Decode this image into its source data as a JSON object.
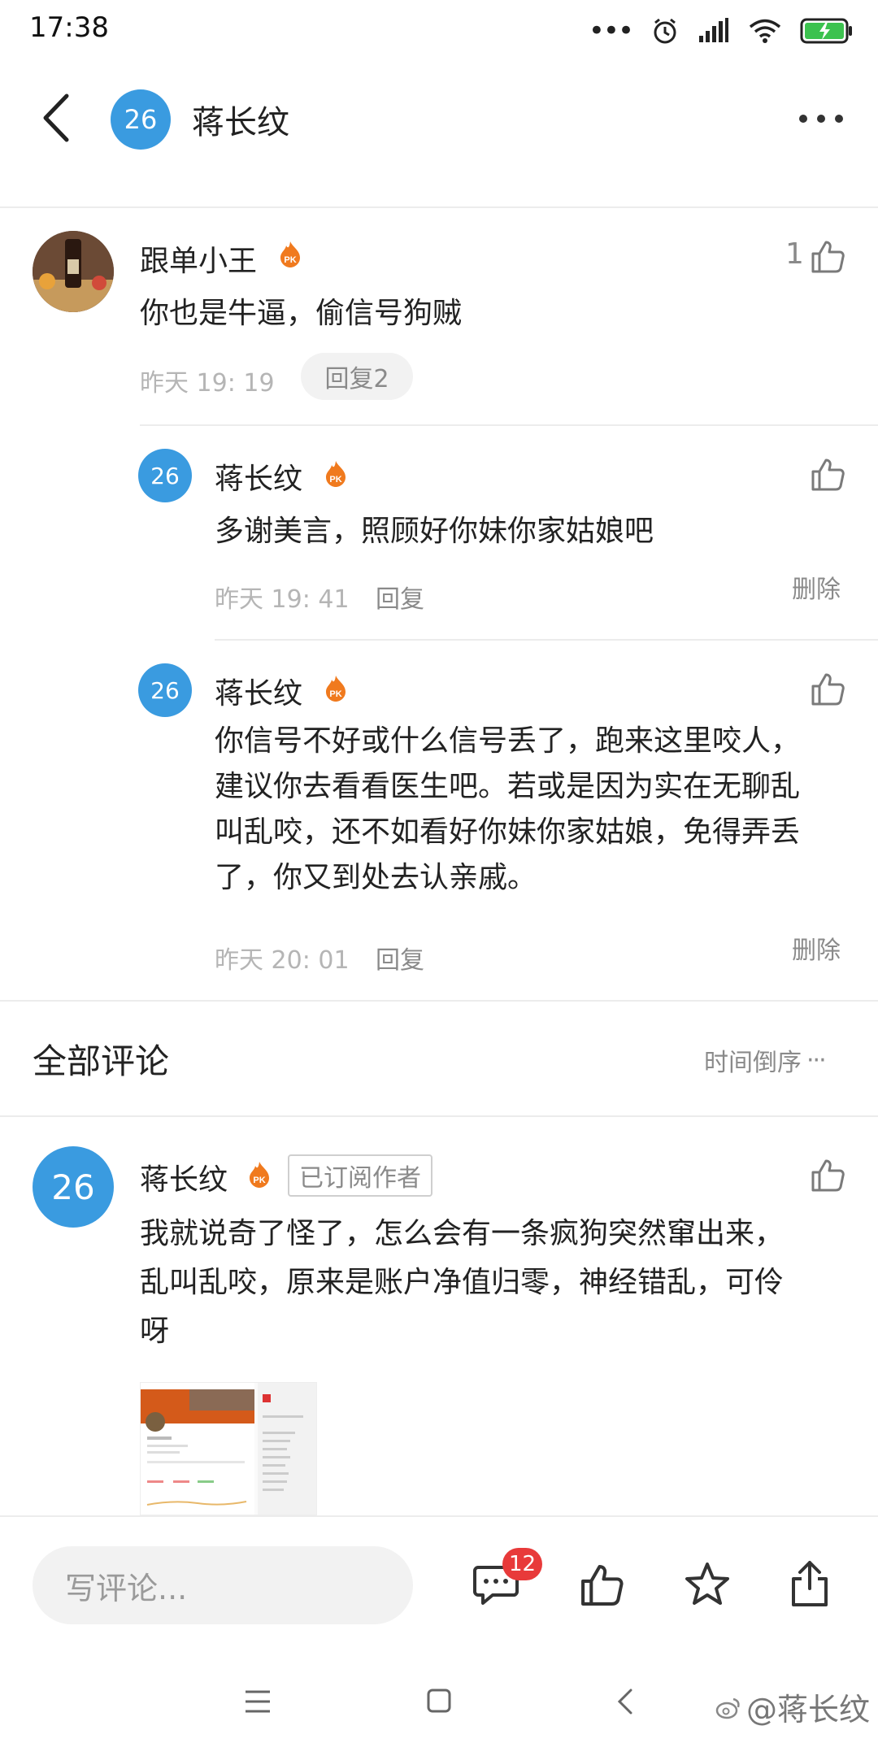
{
  "status": {
    "time": "17:38"
  },
  "header": {
    "avatar_text": "26",
    "title": "蒋长纹"
  },
  "comment": {
    "author": "跟单小王",
    "text": "你也是牛逼，偷信号狗贼",
    "time": "昨天 19: 19",
    "reply_count_label": "回复2",
    "like_count": "1"
  },
  "replies": [
    {
      "avatar_text": "26",
      "author": "蒋长纹",
      "text": "多谢美言，照顾好你妹你家姑娘吧",
      "time": "昨天 19: 41",
      "reply_label": "回复",
      "delete_label": "删除"
    },
    {
      "avatar_text": "26",
      "author": "蒋长纹",
      "text_lines": [
        "你信号不好或什么信号丢了，跑来这里咬人，",
        "建议你去看看医生吧。若或是因为实在无聊乱",
        "叫乱咬，还不如看好你妹你家姑娘，免得弄丢",
        "了，你又到处去认亲戚。"
      ],
      "time": "昨天 20: 01",
      "reply_label": "回复",
      "delete_label": "删除"
    }
  ],
  "all_comments": {
    "title": "全部评论",
    "sort_label": "时间倒序"
  },
  "top_comment": {
    "avatar_text": "26",
    "author": "蒋长纹",
    "tag": "已订阅作者",
    "text_lines": [
      "我就说奇了怪了，怎么会有一条疯狗突然窜出来，",
      "乱叫乱咬，原来是账户净值归零，神经错乱，可伶",
      "呀"
    ]
  },
  "bottom": {
    "placeholder": "写评论...",
    "comment_badge": "12"
  },
  "watermark": "@蒋长纹",
  "colors": {
    "accent": "#3a9be0",
    "badge": "#e83a3a",
    "pk": "#f07a1e"
  }
}
